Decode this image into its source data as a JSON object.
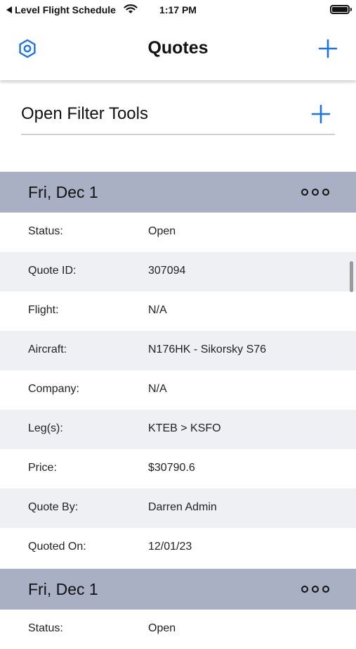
{
  "status_bar": {
    "back_app": "Level Flight Schedule",
    "time": "1:17 PM"
  },
  "nav": {
    "title": "Quotes",
    "accent": "#1a73e8"
  },
  "filter": {
    "label": "Open Filter Tools"
  },
  "quotes": [
    {
      "date": "Fri, Dec 1",
      "fields": [
        {
          "label": "Status:",
          "value": "Open"
        },
        {
          "label": "Quote ID:",
          "value": "307094"
        },
        {
          "label": "Flight:",
          "value": "N/A"
        },
        {
          "label": "Aircraft:",
          "value": "N176HK - Sikorsky S76"
        },
        {
          "label": "Company:",
          "value": "N/A"
        },
        {
          "label": "Leg(s):",
          "value": "KTEB > KSFO"
        },
        {
          "label": "Price:",
          "value": "$30790.6"
        },
        {
          "label": "Quote By:",
          "value": "Darren Admin"
        },
        {
          "label": "Quoted On:",
          "value": "12/01/23"
        }
      ]
    },
    {
      "date": "Fri, Dec 1",
      "fields": [
        {
          "label": "Status:",
          "value": "Open"
        }
      ]
    }
  ]
}
